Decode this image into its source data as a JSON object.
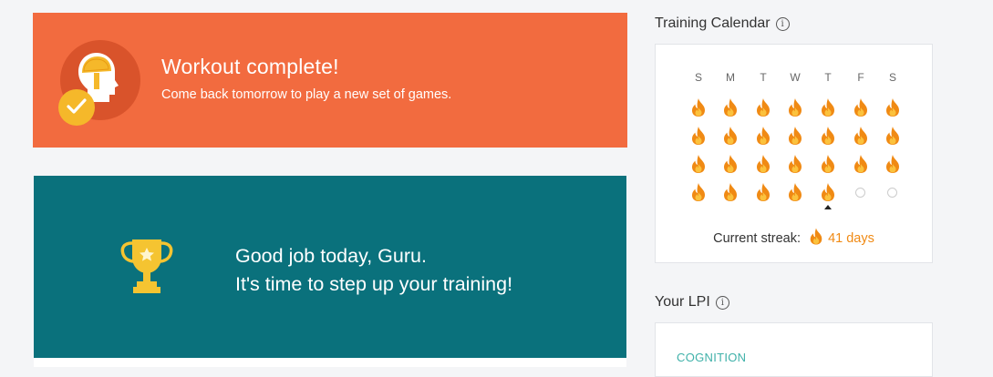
{
  "banner": {
    "title": "Workout complete!",
    "subtitle": "Come back tomorrow to play a new set of games.",
    "icon": "brain-head-icon",
    "badge_icon": "checkmark-icon",
    "color": "#f26b3f"
  },
  "congrats": {
    "line1": "Good job today, Guru.",
    "line2": "It's time to step up your training!",
    "icon": "trophy-icon",
    "color": "#0a717c"
  },
  "calendar": {
    "title": "Training Calendar",
    "info_icon": "info-icon",
    "weekdays": [
      "S",
      "M",
      "T",
      "W",
      "T",
      "F",
      "S"
    ],
    "weeks": [
      [
        1,
        1,
        1,
        1,
        1,
        1,
        1
      ],
      [
        1,
        1,
        1,
        1,
        1,
        1,
        1
      ],
      [
        1,
        1,
        1,
        1,
        1,
        1,
        1
      ],
      [
        1,
        1,
        1,
        1,
        1,
        0,
        0
      ]
    ],
    "streak_label": "Current streak:",
    "streak_value": "41 days",
    "flame_color": "#f08a14"
  },
  "lpi": {
    "title": "Your LPI",
    "info_icon": "info-icon",
    "section": "COGNITION"
  }
}
